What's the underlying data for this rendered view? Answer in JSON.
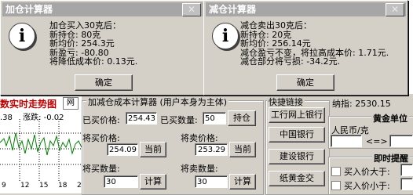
{
  "left_dialog": {
    "title": "加仓计算器",
    "lines": [
      "加仓买入30克后：",
      "新持仓: 80克",
      "新均价: 254.3元",
      "新盈亏: -80.80",
      "将降低成本价: 0.13元."
    ],
    "ok_label": "确定"
  },
  "right_dialog": {
    "title": "减仓计算器",
    "lines": [
      "减仓卖出30克后：",
      "新持仓: 20克",
      "新均价: 256.14元",
      "减仓盈亏不变，将拉高成本价: 1.71元.",
      "减仓部分将亏损: -34.2元."
    ],
    "ok_label": "确定"
  },
  "bg_chart": {
    "title": "数实时走势图",
    "net_button": "网",
    "sub_left": ".38",
    "sub_right": "涨跌: -0.02",
    "ticks": [
      "9",
      "12",
      "15",
      "18",
      "2"
    ]
  },
  "calc": {
    "title": "加减仓成本计算器 (用户本身为主体)",
    "bought_price_label": "已买价格:",
    "bought_price_value": "254.43",
    "bought_qty_label": "已买数量:",
    "bought_qty_value": "50",
    "hold_button": "持仓",
    "buy_price_label": "将买价格:",
    "buy_price_value": "254.09",
    "buy_current_button": "当前",
    "sell_price_label": "将卖价格:",
    "sell_price_value": "253.29",
    "sell_current_button": "当前",
    "buy_qty_label": "将买数量:",
    "buy_qty_value": "30",
    "buy_calc_button": "计算",
    "sell_qty_label": "将卖数量:",
    "sell_qty_value": "30",
    "sell_calc_button": "计算"
  },
  "links": {
    "title": "快捷链接",
    "buttons": [
      "工行网上银行",
      "中国银行",
      "建设银行",
      "纸黄金交"
    ]
  },
  "right_panel": {
    "nasdaq_label": "纳指: 2530.15",
    "gold_unit_title": "黄金单位",
    "rmb_label": "人民币/克",
    "swap_arrow": "<=>",
    "alert_title": "即时提醒",
    "buy_above_label": "买入价大于:",
    "buy_below_label": "买入价小于:"
  },
  "colors": {
    "accent_red": "#c00000",
    "chart_line": "#008000",
    "title_bar": "#a6a6a6"
  }
}
